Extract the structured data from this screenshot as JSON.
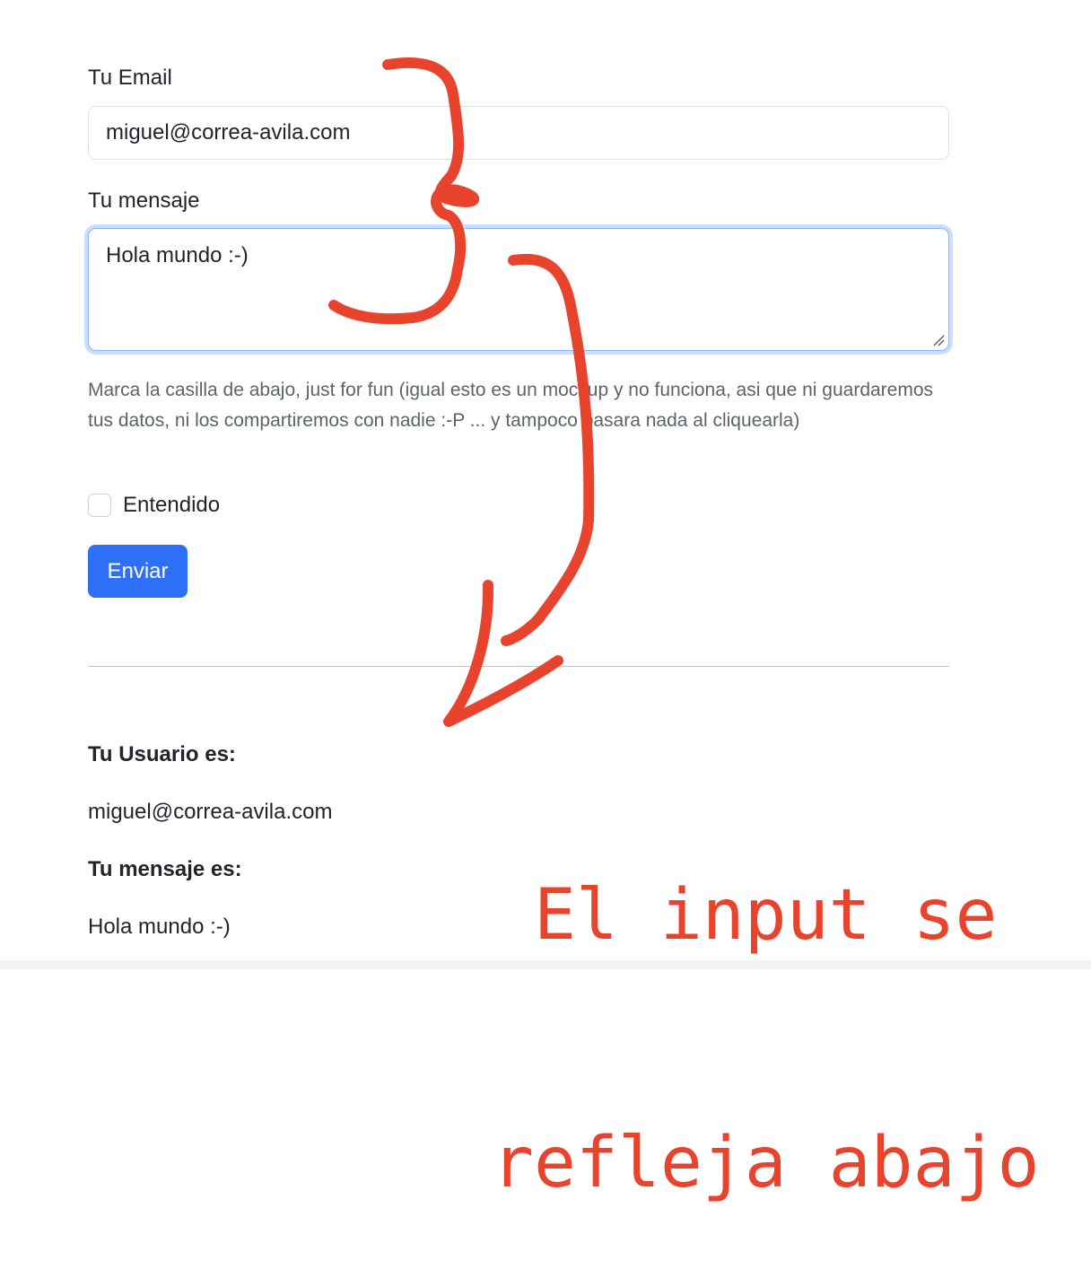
{
  "form": {
    "email_label": "Tu Email",
    "email_value": "miguel@correa-avila.com",
    "message_label": "Tu mensaje",
    "message_value": "Hola mundo :-)",
    "help_text": "Marca la casilla de abajo, just for fun (igual esto es un mockup y no funciona, asi que ni guardaremos tus datos, ni los compartiremos con nadie :-P ... y tampoco pasara nada al cliquearla)",
    "checkbox_label": "Entendido",
    "checkbox_checked": false,
    "submit_label": "Enviar"
  },
  "result": {
    "user_heading": "Tu Usuario es:",
    "user_value": "miguel@correa-avila.com",
    "message_heading": "Tu mensaje es:",
    "message_value": "Hola mundo :-)"
  },
  "annotation": {
    "line1": "El input se",
    "line2": "refleja abajo",
    "color": "#e8432d"
  },
  "colors": {
    "primary_button": "#2d6ff7",
    "focus_ring": "#86b7fe",
    "muted_text": "#5c636a"
  }
}
